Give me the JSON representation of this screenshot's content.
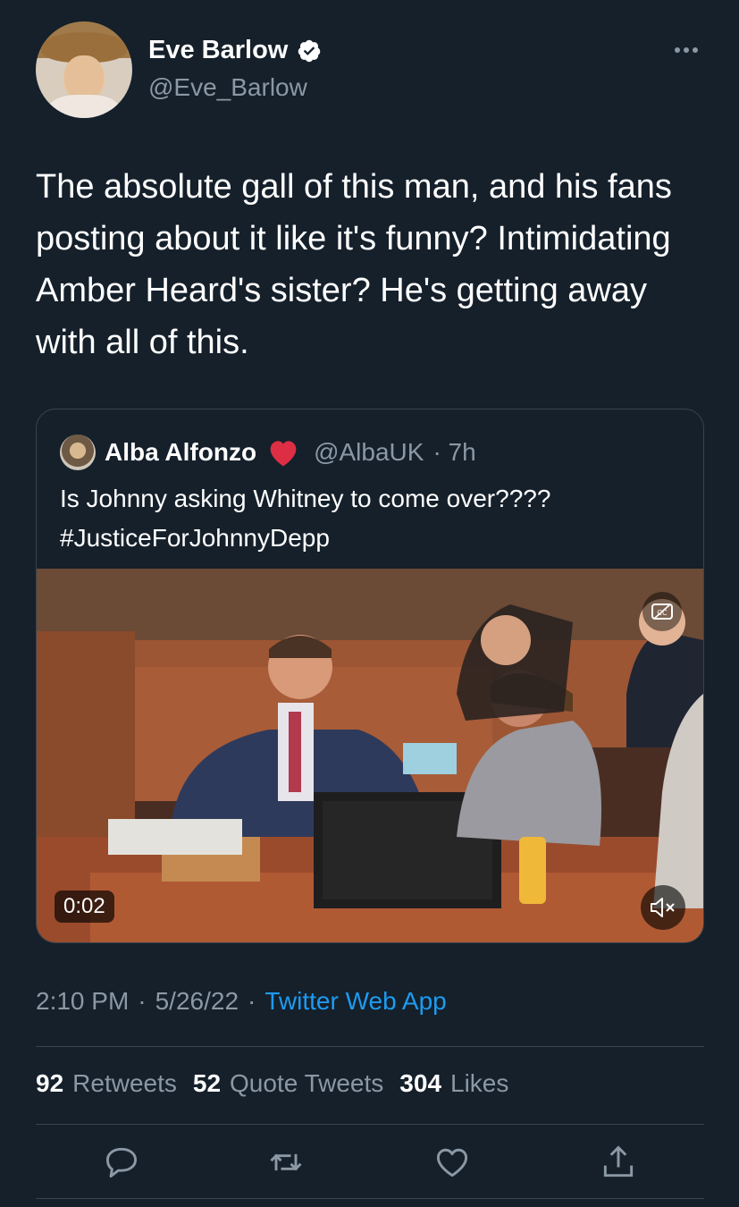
{
  "author": {
    "display_name": "Eve Barlow",
    "handle": "@Eve_Barlow",
    "verified": true,
    "avatar_icon": "profile-photo"
  },
  "tweet": {
    "text": "The absolute gall of this man, and his fans posting about it like it's funny? Intimidating Amber Heard's sister? He's getting away with all of this."
  },
  "quoted": {
    "display_name": "Alba Alfonzo",
    "emoji": "red-heart",
    "handle": "@AlbaUK",
    "time": "· 7h",
    "text_line1": "Is Johnny asking Whitney to come over????",
    "text_line2": "#JusticeForJohnnyDepp",
    "video": {
      "duration": "0:02",
      "muted": true
    }
  },
  "meta": {
    "time": "2:10 PM",
    "sep1": "·",
    "date": "5/26/22",
    "sep2": "·",
    "source": "Twitter Web App"
  },
  "stats": {
    "retweets_count": "92",
    "retweets_label": "Retweets",
    "quotes_count": "52",
    "quotes_label": "Quote Tweets",
    "likes_count": "304",
    "likes_label": "Likes"
  },
  "colors": {
    "background": "#15202b",
    "text_primary": "#ffffff",
    "text_secondary": "#8b98a5",
    "link": "#1d9bf0",
    "verified": "#ffffff",
    "heart": "#e0245e",
    "border": "#38444d"
  }
}
